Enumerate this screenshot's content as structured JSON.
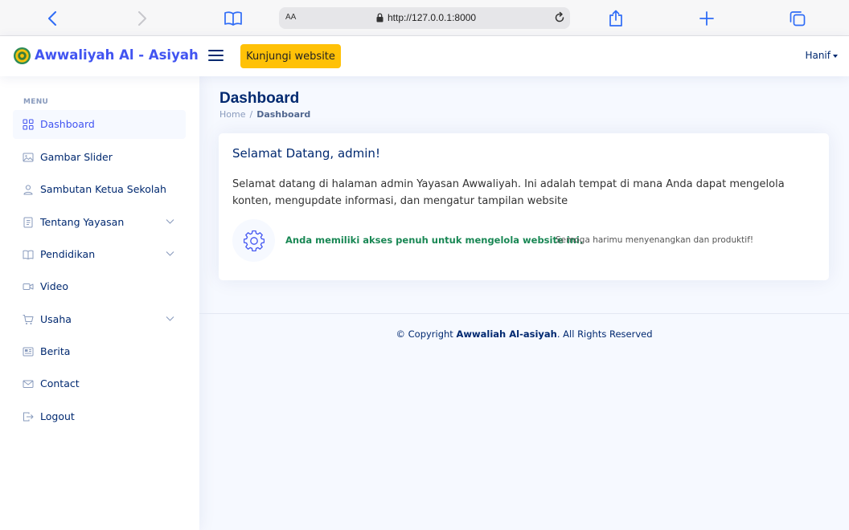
{
  "browser": {
    "aa_label": "AA",
    "url": "http://127.0.0.1:8000"
  },
  "header": {
    "brand": "Awwaliyah Al - Asiyah",
    "visit_button": "Kunjungi website",
    "user_name": "Hanif"
  },
  "sidebar": {
    "heading": "MENU",
    "items": [
      {
        "label": "Dashboard",
        "icon": "grid-icon",
        "active": true
      },
      {
        "label": "Gambar Slider",
        "icon": "image-icon"
      },
      {
        "label": "Sambutan Ketua Sekolah",
        "icon": "person-icon"
      },
      {
        "label": "Tentang Yayasan",
        "icon": "journal-icon",
        "has_children": true
      },
      {
        "label": "Pendidikan",
        "icon": "book-icon",
        "has_children": true
      },
      {
        "label": "Video",
        "icon": "camera-video-icon"
      },
      {
        "label": "Usaha",
        "icon": "cart-icon",
        "has_children": true
      },
      {
        "label": "Berita",
        "icon": "newspaper-icon"
      },
      {
        "label": "Contact",
        "icon": "envelope-icon"
      },
      {
        "label": "Logout",
        "icon": "logout-icon"
      }
    ]
  },
  "main": {
    "title": "Dashboard",
    "breadcrumb": {
      "home": "Home",
      "current": "Dashboard"
    },
    "card": {
      "title": "Selamat Datang, admin!",
      "text": "Selamat datang di halaman admin Yayasan Awwaliyah. Ini adalah tempat di mana Anda dapat mengelola konten, mengupdate informasi, dan mengatur tampilan website",
      "access": "Anda memiliki akses penuh untuk mengelola website ini.",
      "wish": "Semoga harimu menyenangkan dan produktif!"
    }
  },
  "footer": {
    "prefix": "© Copyright",
    "owner": "Awwaliah Al-asiyah",
    "suffix": ". All Rights Reserved"
  },
  "colors": {
    "primary": "#4154f1",
    "navy": "#012970",
    "accent_button": "#ffc107",
    "success": "#198754",
    "page_background": "#f6f9ff"
  }
}
